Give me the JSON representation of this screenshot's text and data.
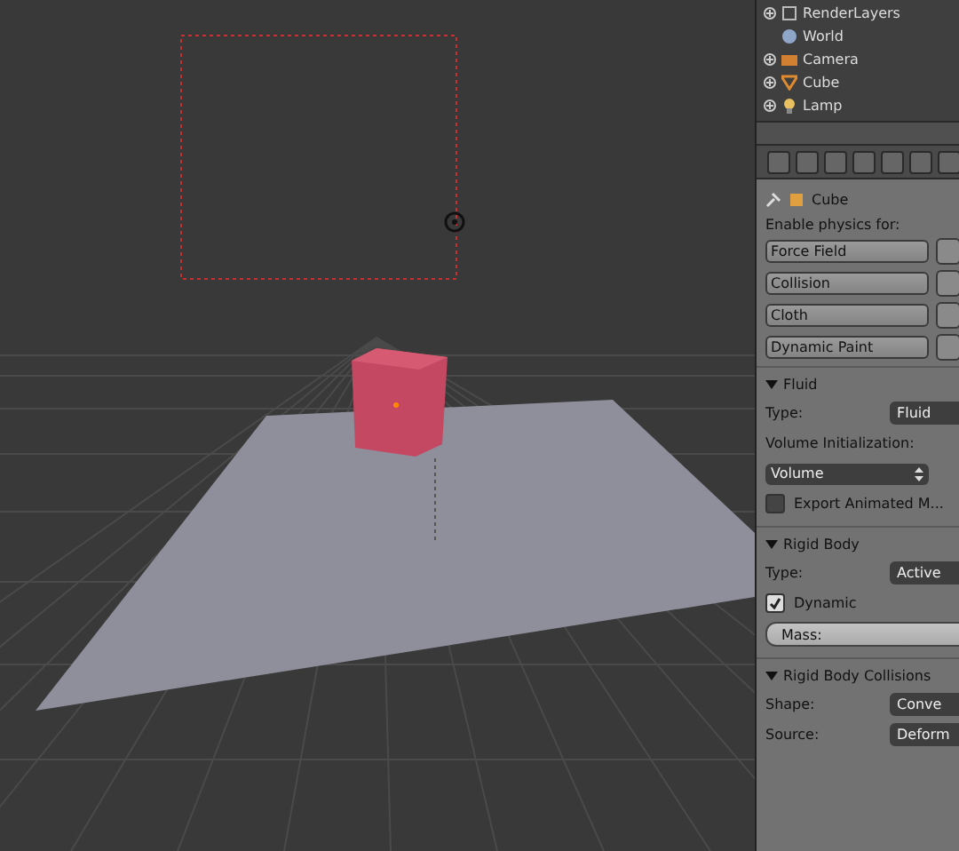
{
  "outliner": {
    "items": [
      {
        "label": "RenderLayers",
        "kind": "layers",
        "has_toggle": true
      },
      {
        "label": "World",
        "kind": "world",
        "has_toggle": false
      },
      {
        "label": "Camera",
        "kind": "camera",
        "has_toggle": true
      },
      {
        "label": "Cube",
        "kind": "cube",
        "has_toggle": true
      },
      {
        "label": "Lamp",
        "kind": "lamp",
        "has_toggle": true
      }
    ]
  },
  "context": {
    "object": "Cube"
  },
  "physics": {
    "heading": "Enable physics for:",
    "buttons": [
      "Force Field",
      "Collision",
      "Cloth",
      "Dynamic Paint"
    ]
  },
  "panels": [
    {
      "title": "Fluid",
      "expanded": true,
      "rows": [
        {
          "kind": "select",
          "label": "Type:",
          "value": "Fluid"
        },
        {
          "kind": "text",
          "label": "Volume Initialization:"
        },
        {
          "kind": "dropdown",
          "value": "Volume"
        },
        {
          "kind": "checkbox",
          "label": "Export Animated M...",
          "checked": false
        }
      ]
    },
    {
      "title": "Rigid Body",
      "expanded": true,
      "rows": [
        {
          "kind": "select",
          "label": "Type:",
          "value": "Active"
        },
        {
          "kind": "checkbox",
          "label": "Dynamic",
          "checked": true
        },
        {
          "kind": "slider",
          "label": "Mass:"
        }
      ]
    },
    {
      "title": "Rigid Body Collisions",
      "expanded": true,
      "rows": [
        {
          "kind": "select",
          "label": "Shape:",
          "value": "Conve"
        },
        {
          "kind": "select",
          "label": "Source:",
          "value": "Deform"
        }
      ]
    }
  ]
}
